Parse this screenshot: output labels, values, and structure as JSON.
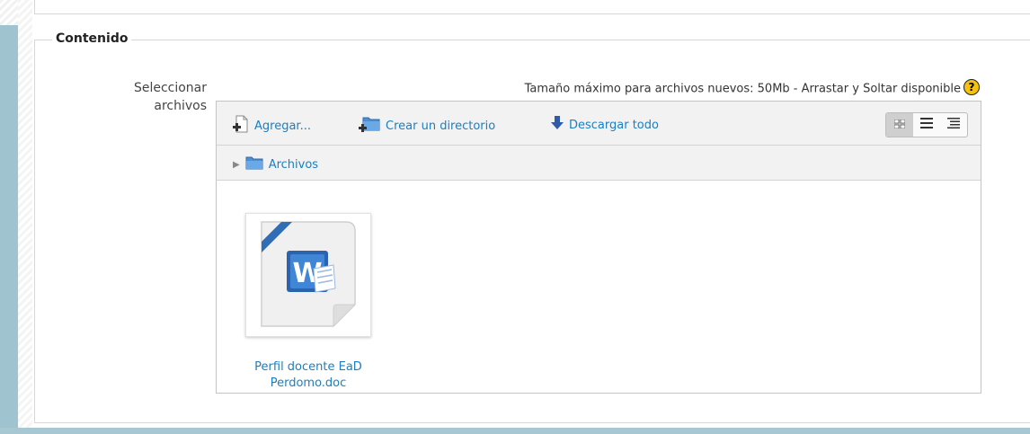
{
  "section": {
    "legend": "Contenido"
  },
  "field": {
    "label_line1": "Seleccionar",
    "label_line2": "archivos"
  },
  "info": {
    "text": "Tamaño máximo para archivos nuevos: 50Mb - Arrastar y Soltar disponible",
    "help_icon": "help-icon",
    "help_symbol": "?"
  },
  "toolbar": {
    "add_label": "Agregar...",
    "create_dir_label": "Crear un directorio",
    "download_label": "Descargar todo",
    "views": [
      {
        "name": "icons-view",
        "symbol": "▦",
        "active": true
      },
      {
        "name": "list-view",
        "symbol": "≣",
        "active": false
      },
      {
        "name": "tree-view",
        "symbol": "☰",
        "active": false
      }
    ]
  },
  "path": {
    "folder_label": "Archivos"
  },
  "files": [
    {
      "name_line1": "Perfil docente EaD",
      "name_line2": "Perdomo.doc",
      "icon": "word-document-icon"
    }
  ],
  "colors": {
    "link": "#1a7fc1",
    "side_blue": "#9fc4cf",
    "help_yellow": "#f7c20c"
  }
}
